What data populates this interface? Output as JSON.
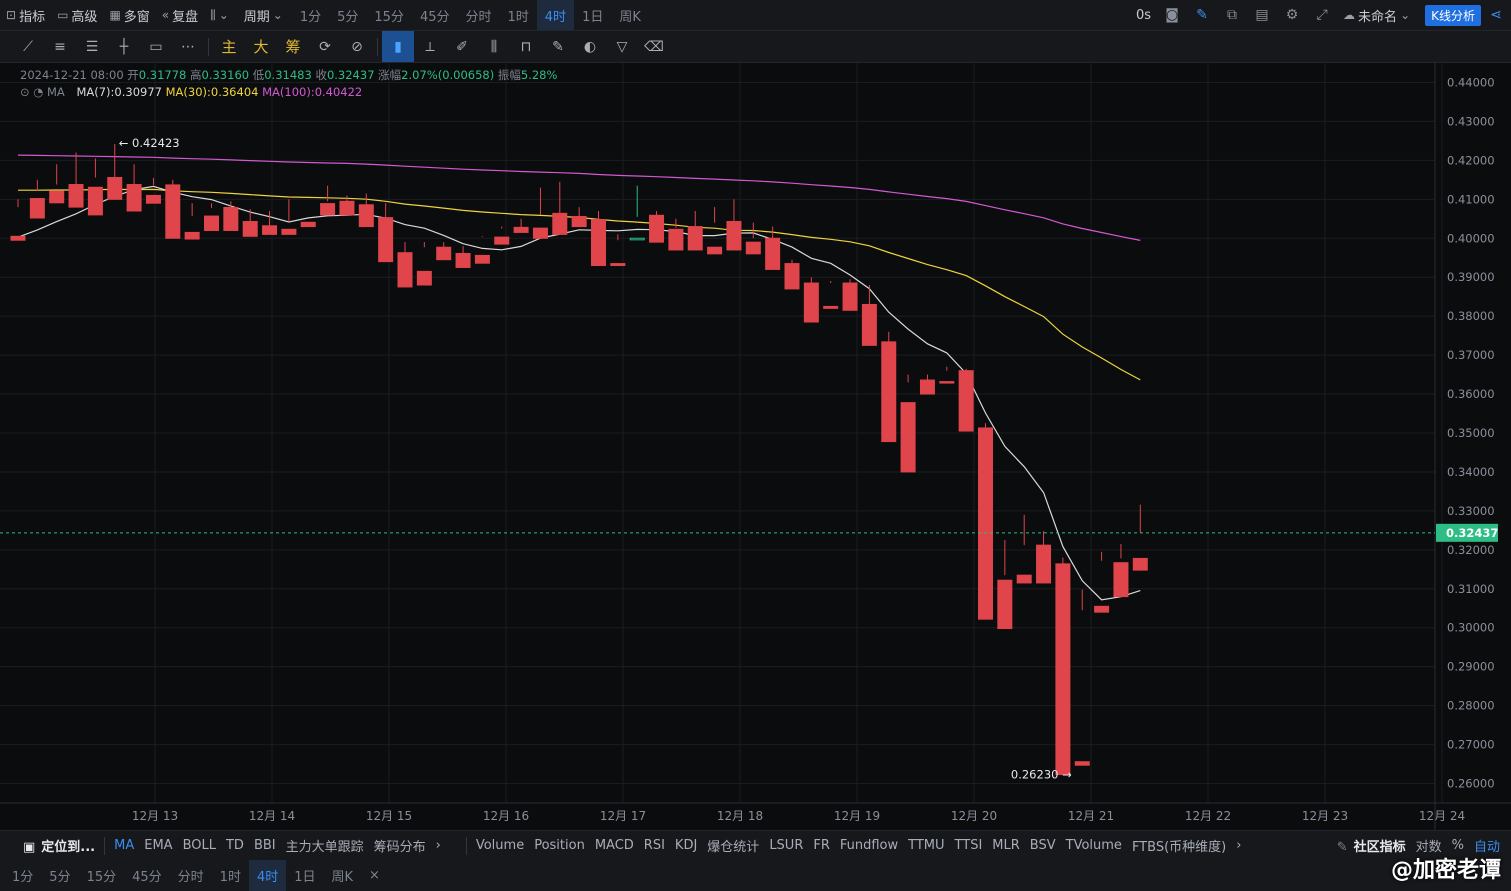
{
  "topbar": {
    "indicator": "指标",
    "advanced": "高级",
    "multiwin": "多窗",
    "replay": "复盘",
    "period": "周期",
    "timeframes": [
      "1分",
      "5分",
      "15分",
      "45分",
      "分时",
      "1时",
      "4时",
      "1日",
      "周K"
    ],
    "active_timeframe": "4时",
    "countdown": "0s",
    "layout_name": "未命名",
    "kline_button": "K线分析"
  },
  "drawbar": {
    "text_tools": [
      "主",
      "大",
      "筹"
    ]
  },
  "legend": {
    "date": "2024-12-21 08:00",
    "open_label": "开",
    "open": "0.31778",
    "high_label": "高",
    "high": "0.33160",
    "low_label": "低",
    "low": "0.31483",
    "close_label": "收",
    "close": "0.32437",
    "change_label": "涨幅",
    "change": "2.07%(0.00658)",
    "amp_label": "振幅",
    "amp": "5.28%",
    "ma_name": "MA",
    "ma7": "MA(7):0.30977",
    "ma30": "MA(30):0.36404",
    "ma100": "MA(100):0.40422"
  },
  "colors": {
    "up": "#2ebd85",
    "down": "#e0454b",
    "ma7": "#d9d9d9",
    "ma30": "#f0d33c",
    "ma100": "#d359d3",
    "price_line": "#2ebd85",
    "accent": "#3b8ef0"
  },
  "chart_data": {
    "type": "candlestick",
    "timeframe": "4时",
    "ylim": [
      0.255,
      0.445
    ],
    "y_ticks": [
      "0.44000",
      "0.43000",
      "0.42000",
      "0.41000",
      "0.40000",
      "0.39000",
      "0.38000",
      "0.37000",
      "0.36000",
      "0.35000",
      "0.34000",
      "0.33000",
      "0.32000",
      "0.31000",
      "0.30000",
      "0.29000",
      "0.28000",
      "0.27000",
      "0.26000"
    ],
    "x_labels": [
      "12月 13",
      "12月 14",
      "12月 15",
      "12月 16",
      "12月 17",
      "12月 18",
      "12月 19",
      "12月 20",
      "12月 21",
      "12月 22",
      "12月 23",
      "12月 24"
    ],
    "current_price": "0.32437",
    "high_annotation": "0.42423",
    "low_annotation": "0.26230",
    "candles": [
      [
        0.4005,
        0.41,
        0.408,
        0.3995
      ],
      [
        0.4102,
        0.415,
        0.4121,
        0.4052
      ],
      [
        0.4121,
        0.419,
        0.4138,
        0.4091
      ],
      [
        0.4138,
        0.422,
        0.4131,
        0.408
      ],
      [
        0.4131,
        0.4205,
        0.4156,
        0.406
      ],
      [
        0.4156,
        0.4242,
        0.4139,
        0.41
      ],
      [
        0.4138,
        0.419,
        0.411,
        0.407
      ],
      [
        0.411,
        0.4155,
        0.4137,
        0.409
      ],
      [
        0.4137,
        0.415,
        0.4017,
        0.4
      ],
      [
        0.4015,
        0.409,
        0.4057,
        0.3998
      ],
      [
        0.4057,
        0.409,
        0.4078,
        0.402
      ],
      [
        0.4079,
        0.4095,
        0.404,
        0.402
      ],
      [
        0.4043,
        0.4075,
        0.4032,
        0.4005
      ],
      [
        0.4032,
        0.407,
        0.4027,
        0.401
      ],
      [
        0.4023,
        0.41,
        0.4042,
        0.401
      ],
      [
        0.4041,
        0.409,
        0.409,
        0.403
      ],
      [
        0.4089,
        0.4135,
        0.4095,
        0.406
      ],
      [
        0.4095,
        0.411,
        0.4089,
        0.406
      ],
      [
        0.4086,
        0.4115,
        0.4055,
        0.403
      ],
      [
        0.4053,
        0.409,
        0.3963,
        0.394
      ],
      [
        0.3963,
        0.399,
        0.3912,
        0.3875
      ],
      [
        0.3915,
        0.399,
        0.3977,
        0.388
      ],
      [
        0.3977,
        0.399,
        0.3961,
        0.3945
      ],
      [
        0.3961,
        0.398,
        0.3946,
        0.3925
      ],
      [
        0.3956,
        0.4005,
        0.4003,
        0.3936
      ],
      [
        0.4003,
        0.4025,
        0.403,
        0.3985
      ],
      [
        0.4028,
        0.405,
        0.4025,
        0.4015
      ],
      [
        0.4026,
        0.413,
        0.4061,
        0.4
      ],
      [
        0.4064,
        0.4145,
        0.4048,
        0.401
      ],
      [
        0.4056,
        0.408,
        0.404,
        0.403
      ],
      [
        0.4048,
        0.407,
        0.3935,
        0.393
      ],
      [
        0.3935,
        0.401,
        0.3995,
        0.393
      ],
      [
        0.3996,
        0.4135,
        0.4055,
        0.4
      ],
      [
        0.4059,
        0.407,
        0.402,
        0.399
      ],
      [
        0.4023,
        0.405,
        0.4027,
        0.397
      ],
      [
        0.403,
        0.407,
        0.3975,
        0.397
      ],
      [
        0.3977,
        0.408,
        0.404,
        0.396
      ],
      [
        0.4043,
        0.41,
        0.398,
        0.397
      ],
      [
        0.399,
        0.404,
        0.4,
        0.396
      ],
      [
        0.4,
        0.403,
        0.3935,
        0.392
      ],
      [
        0.3935,
        0.3945,
        0.3885,
        0.387
      ],
      [
        0.3885,
        0.39,
        0.3825,
        0.3785
      ],
      [
        0.3825,
        0.389,
        0.3885,
        0.382
      ],
      [
        0.3885,
        0.3895,
        0.383,
        0.3815
      ],
      [
        0.383,
        0.388,
        0.3734,
        0.3725
      ],
      [
        0.3734,
        0.376,
        0.3578,
        0.3478
      ],
      [
        0.3578,
        0.365,
        0.363,
        0.34
      ],
      [
        0.3636,
        0.365,
        0.3622,
        0.36
      ],
      [
        0.3632,
        0.367,
        0.366,
        0.363
      ],
      [
        0.366,
        0.3665,
        0.3513,
        0.3505
      ],
      [
        0.3513,
        0.3525,
        0.3122,
        0.3022
      ],
      [
        0.3122,
        0.3225,
        0.3135,
        0.2998
      ],
      [
        0.3135,
        0.329,
        0.3212,
        0.3115
      ],
      [
        0.3212,
        0.3248,
        0.3164,
        0.3115
      ],
      [
        0.3164,
        0.318,
        0.2652,
        0.2623
      ],
      [
        0.2656,
        0.3098,
        0.3045,
        0.2647
      ],
      [
        0.3055,
        0.3195,
        0.3172,
        0.304
      ],
      [
        0.3167,
        0.3215,
        0.3178,
        0.308
      ],
      [
        0.3178,
        0.3316,
        0.3244,
        0.3148
      ]
    ]
  },
  "indbar": {
    "locate": "定位到...",
    "main_indicators": [
      "MA",
      "EMA",
      "BOLL",
      "TD",
      "BBI",
      "主力大单跟踪",
      "筹码分布"
    ],
    "sub_indicators": [
      "Volume",
      "Position",
      "MACD",
      "RSI",
      "KDJ",
      "爆仓统计",
      "LSUR",
      "FR",
      "Fundflow",
      "TTMU",
      "TTSI",
      "MLR",
      "BSV",
      "TVolume",
      "FTBS(币种维度)"
    ],
    "community": "社区指标",
    "log": "对数",
    "pct": "%",
    "auto": "自动"
  },
  "tfbar": {
    "timeframes": [
      "1分",
      "5分",
      "15分",
      "45分",
      "分时",
      "1时",
      "4时",
      "1日",
      "周K"
    ],
    "close": "×"
  },
  "watermark": "@加密老谭"
}
